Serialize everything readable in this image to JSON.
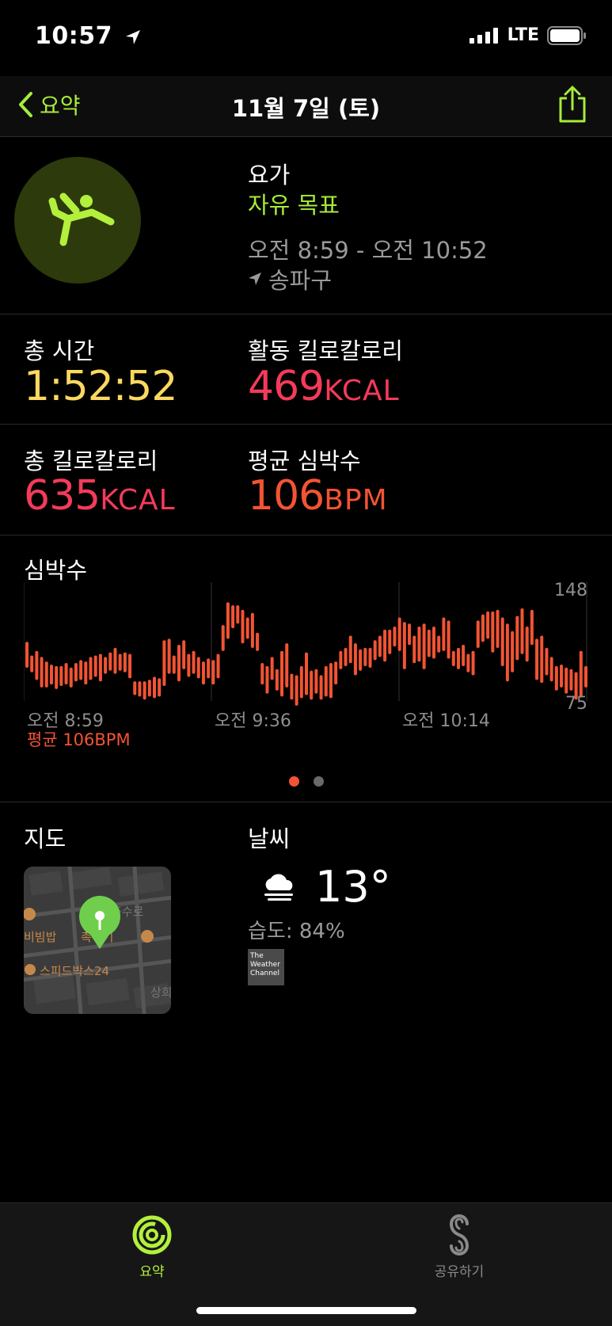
{
  "status": {
    "time": "10:57",
    "network": "LTE"
  },
  "nav": {
    "back_label": "요약",
    "title": "11월 7일 (토)"
  },
  "workout": {
    "name": "요가",
    "goal": "자유 목표",
    "time_range": "오전 8:59 - 오전 10:52",
    "location": "송파구"
  },
  "metrics": {
    "total_time_label": "총 시간",
    "total_time_value": "1:52:52",
    "active_kcal_label": "활동 킬로칼로리",
    "active_kcal_value": "469",
    "active_kcal_unit": "KCAL",
    "total_kcal_label": "총 킬로칼로리",
    "total_kcal_value": "635",
    "total_kcal_unit": "KCAL",
    "avg_hr_label": "평균 심박수",
    "avg_hr_value": "106",
    "avg_hr_unit": "BPM"
  },
  "heart_rate": {
    "title": "심박수",
    "max_label": "148",
    "min_label": "75",
    "time_labels": [
      "오전 8:59",
      "오전 9:36",
      "오전 10:14"
    ],
    "avg_label": "평균 106BPM"
  },
  "chart_data": {
    "type": "bar",
    "ylim": [
      75,
      148
    ],
    "color": "#f25433",
    "ranges": [
      [
        99,
        114
      ],
      [
        96,
        105
      ],
      [
        91,
        108
      ],
      [
        86,
        104
      ],
      [
        86,
        101
      ],
      [
        88,
        99
      ],
      [
        85,
        98
      ],
      [
        87,
        98
      ],
      [
        88,
        100
      ],
      [
        86,
        97
      ],
      [
        90,
        100
      ],
      [
        91,
        102
      ],
      [
        88,
        101
      ],
      [
        91,
        104
      ],
      [
        93,
        105
      ],
      [
        90,
        106
      ],
      [
        95,
        104
      ],
      [
        97,
        107
      ],
      [
        95,
        110
      ],
      [
        97,
        106
      ],
      [
        96,
        107
      ],
      [
        92,
        106
      ],
      [
        81,
        88
      ],
      [
        80,
        88
      ],
      [
        78,
        88
      ],
      [
        80,
        89
      ],
      [
        79,
        91
      ],
      [
        80,
        90
      ],
      [
        87,
        115
      ],
      [
        95,
        116
      ],
      [
        95,
        105
      ],
      [
        90,
        112
      ],
      [
        98,
        115
      ],
      [
        93,
        106
      ],
      [
        95,
        108
      ],
      [
        92,
        104
      ],
      [
        88,
        101
      ],
      [
        92,
        103
      ],
      [
        88,
        102
      ],
      [
        92,
        106
      ],
      [
        110,
        125
      ],
      [
        118,
        140
      ],
      [
        125,
        138
      ],
      [
        128,
        138
      ],
      [
        115,
        135
      ],
      [
        118,
        130
      ],
      [
        112,
        133
      ],
      [
        110,
        120
      ],
      [
        88,
        100
      ],
      [
        82,
        98
      ],
      [
        91,
        104
      ],
      [
        84,
        96
      ],
      [
        80,
        108
      ],
      [
        86,
        113
      ],
      [
        78,
        93
      ],
      [
        74,
        92
      ],
      [
        79,
        98
      ],
      [
        81,
        107
      ],
      [
        78,
        95
      ],
      [
        82,
        96
      ],
      [
        78,
        92
      ],
      [
        80,
        98
      ],
      [
        79,
        100
      ],
      [
        88,
        101
      ],
      [
        98,
        108
      ],
      [
        100,
        110
      ],
      [
        102,
        118
      ],
      [
        94,
        113
      ],
      [
        97,
        109
      ],
      [
        100,
        110
      ],
      [
        99,
        110
      ],
      [
        104,
        115
      ],
      [
        106,
        118
      ],
      [
        103,
        122
      ],
      [
        108,
        122
      ],
      [
        113,
        124
      ],
      [
        110,
        130
      ],
      [
        98,
        127
      ],
      [
        114,
        126
      ],
      [
        102,
        118
      ],
      [
        103,
        124
      ],
      [
        98,
        126
      ],
      [
        106,
        122
      ],
      [
        105,
        124
      ],
      [
        109,
        118
      ],
      [
        110,
        130
      ],
      [
        105,
        128
      ],
      [
        100,
        108
      ],
      [
        98,
        110
      ],
      [
        100,
        112
      ],
      [
        96,
        106
      ],
      [
        94,
        108
      ],
      [
        112,
        128
      ],
      [
        116,
        132
      ],
      [
        118,
        134
      ],
      [
        109,
        134
      ],
      [
        112,
        135
      ],
      [
        100,
        130
      ],
      [
        90,
        126
      ],
      [
        96,
        121
      ],
      [
        104,
        131
      ],
      [
        108,
        136
      ],
      [
        103,
        124
      ],
      [
        114,
        135
      ],
      [
        91,
        116
      ],
      [
        89,
        118
      ],
      [
        94,
        110
      ],
      [
        90,
        104
      ],
      [
        84,
        98
      ],
      [
        86,
        99
      ],
      [
        82,
        97
      ],
      [
        84,
        96
      ],
      [
        78,
        94
      ],
      [
        80,
        108
      ],
      [
        86,
        98
      ]
    ]
  },
  "pager": {
    "dots": 2,
    "active": 0
  },
  "map": {
    "title": "지도",
    "labels": [
      "비빔밥",
      "촉하기",
      "스피드박스24",
      "충수로",
      "상희"
    ]
  },
  "weather": {
    "title": "날씨",
    "temp": "13°",
    "humidity": "습도: 84%",
    "provider": "The Weather Channel"
  },
  "tabs": [
    {
      "label": "요약",
      "active": true,
      "icon": "activity-rings-icon"
    },
    {
      "label": "공유하기",
      "active": false,
      "icon": "sharing-icon"
    }
  ],
  "colors": {
    "accent": "#a6ec3a",
    "heart": "#f25433",
    "kcal": "#f53a5a",
    "time": "#fbd860"
  }
}
